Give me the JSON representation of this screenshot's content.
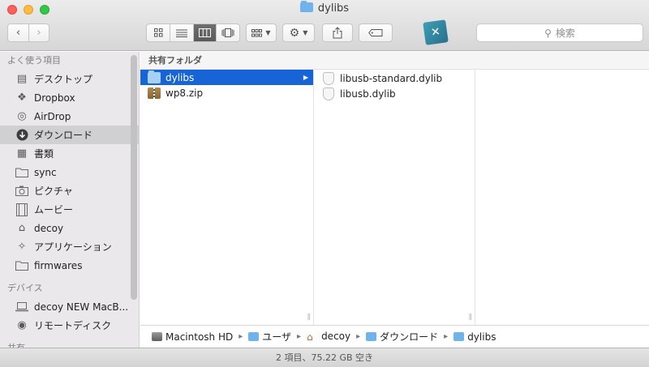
{
  "window": {
    "title": "dylibs"
  },
  "toolbar": {
    "back_icon": "chevron-left-icon",
    "forward_icon": "chevron-right-icon",
    "view_modes": [
      "icon-view",
      "list-view",
      "column-view",
      "cover-flow-view"
    ],
    "active_view": "column-view",
    "search_placeholder": "検索"
  },
  "sidebar": {
    "sections": [
      {
        "header": "よく使う項目",
        "items": [
          {
            "label": "デスクトップ",
            "icon": "desktop-icon"
          },
          {
            "label": "Dropbox",
            "icon": "dropbox-icon"
          },
          {
            "label": "AirDrop",
            "icon": "airdrop-icon"
          },
          {
            "label": "ダウンロード",
            "icon": "download-icon",
            "selected": true
          },
          {
            "label": "書類",
            "icon": "documents-icon"
          },
          {
            "label": "sync",
            "icon": "folder-icon"
          },
          {
            "label": "ピクチャ",
            "icon": "camera-icon"
          },
          {
            "label": "ムービー",
            "icon": "film-icon"
          },
          {
            "label": "decoy",
            "icon": "home-icon"
          },
          {
            "label": "アプリケーション",
            "icon": "applications-icon"
          },
          {
            "label": "firmwares",
            "icon": "folder-icon"
          }
        ]
      },
      {
        "header": "デバイス",
        "items": [
          {
            "label": "decoy NEW MacB...",
            "icon": "laptop-icon"
          },
          {
            "label": "リモートディスク",
            "icon": "remote-disc-icon"
          }
        ]
      },
      {
        "header": "共有",
        "items": []
      }
    ]
  },
  "columns": {
    "header": "共有フォルダ",
    "col1": [
      {
        "name": "dylibs",
        "type": "folder",
        "selected": true
      },
      {
        "name": "wp8.zip",
        "type": "zip"
      }
    ],
    "col2": [
      {
        "name": "libusb-standard.dylib",
        "type": "dylib"
      },
      {
        "name": "libusb.dylib",
        "type": "dylib"
      }
    ]
  },
  "pathbar": [
    {
      "label": "Macintosh HD",
      "icon": "hard-drive-icon"
    },
    {
      "label": "ユーザ",
      "icon": "folder-icon"
    },
    {
      "label": "decoy",
      "icon": "home-icon"
    },
    {
      "label": "ダウンロード",
      "icon": "folder-icon"
    },
    {
      "label": "dylibs",
      "icon": "folder-icon"
    }
  ],
  "status": "2 項目、75.22 GB 空き"
}
